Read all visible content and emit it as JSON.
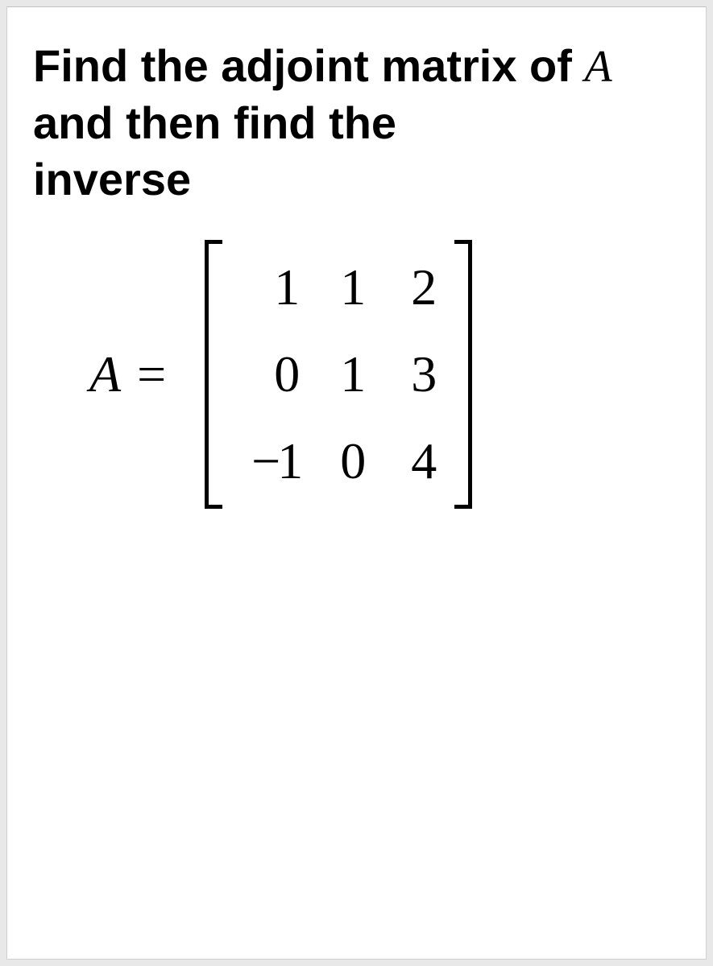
{
  "question": {
    "part1": "Find the adjoint matrix of",
    "var": "A",
    "part2": " and then find the",
    "part3": "inverse"
  },
  "equation": {
    "label": "A",
    "equals": "=",
    "matrix": {
      "r1c1": "1",
      "r1c2": "1",
      "r1c3": "2",
      "r2c1": "0",
      "r2c2": "1",
      "r2c3": "3",
      "r3c1": "−1",
      "r3c2": "0",
      "r3c3": "4"
    }
  }
}
